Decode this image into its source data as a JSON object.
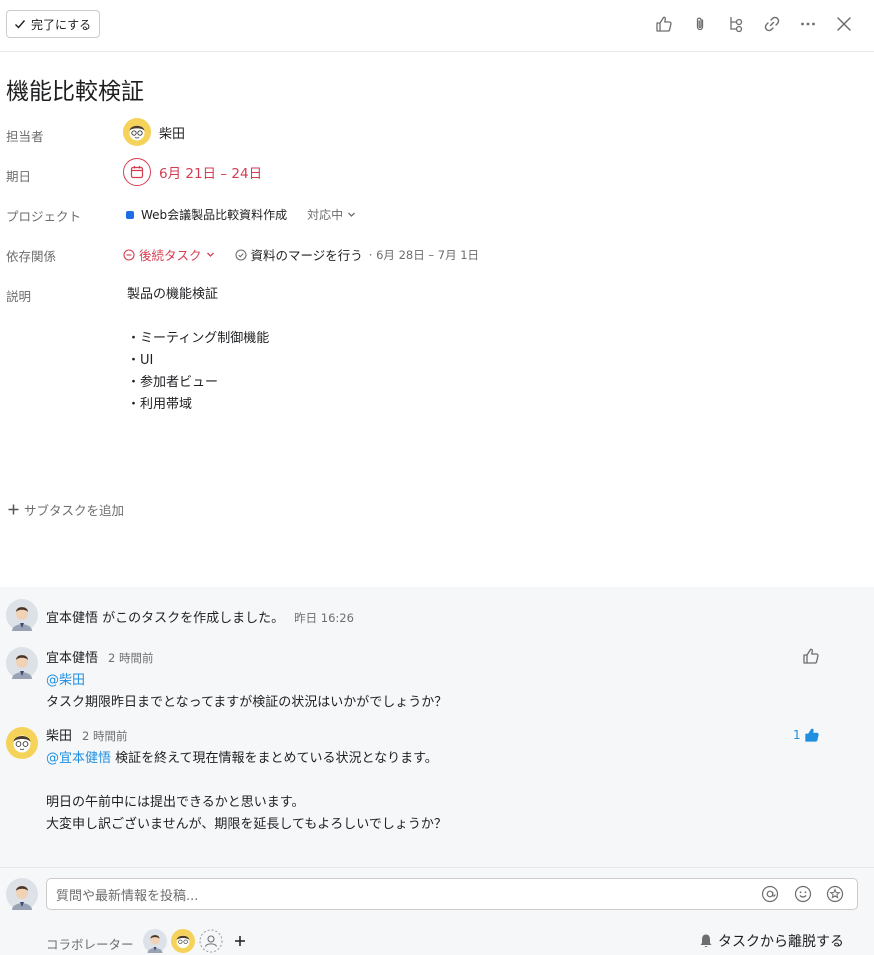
{
  "toolbar": {
    "complete_label": "完了にする",
    "icons": [
      "like-icon",
      "attachment-icon",
      "subtask-icon",
      "link-icon",
      "more-icon",
      "close-icon"
    ]
  },
  "task": {
    "title": "機能比較検証"
  },
  "fields": {
    "assignee_label": "担当者",
    "assignee_name": "柴田",
    "due_label": "期日",
    "due_value": "6月 21日 – 24日",
    "project_label": "プロジェクト",
    "project_name": "Web会議製品比較資料作成",
    "project_status": "対応中",
    "dependency_label": "依存関係",
    "dependency_type": "後続タスク",
    "dependency_task": "資料のマージを行う",
    "dependency_date": "· 6月 28日 – 7月 1日",
    "description_label": "説明"
  },
  "description": {
    "lines": [
      "製品の機能検証",
      "",
      "・ミーティング制御機能",
      "・UI",
      "・参加者ビュー",
      "・利用帯域"
    ]
  },
  "subtask": {
    "add_label": "サブタスクを追加"
  },
  "activity": {
    "created": {
      "text": "宜本健悟 がこのタスクを作成しました。",
      "time": "昨日 16:26"
    },
    "comments": [
      {
        "author": "宜本健悟",
        "time": "2 時間前",
        "mention": "@柴田",
        "lines": [
          "タスク期限昨日までとなってますが検証の状況はいかがでしょうか？"
        ],
        "likes": ""
      },
      {
        "author": "柴田",
        "time": "2 時間前",
        "mention": "@宜本健悟",
        "first_line": " 検証を終えて現在情報をまとめている状況となります。",
        "lines": [
          "明日の午前中には提出できるかと思います。",
          "大変申し訳ございませんが、期限を延長してもよろしいでしょうか？"
        ],
        "likes": "1"
      }
    ]
  },
  "composer": {
    "placeholder": "質問や最新情報を投稿..."
  },
  "collaborators": {
    "label": "コラボレーター",
    "leave_label": "タスクから離脱する"
  },
  "colors": {
    "accent_red": "#d43d51",
    "mention_blue": "#1f8fe0",
    "project_blue": "#1c6de6"
  }
}
